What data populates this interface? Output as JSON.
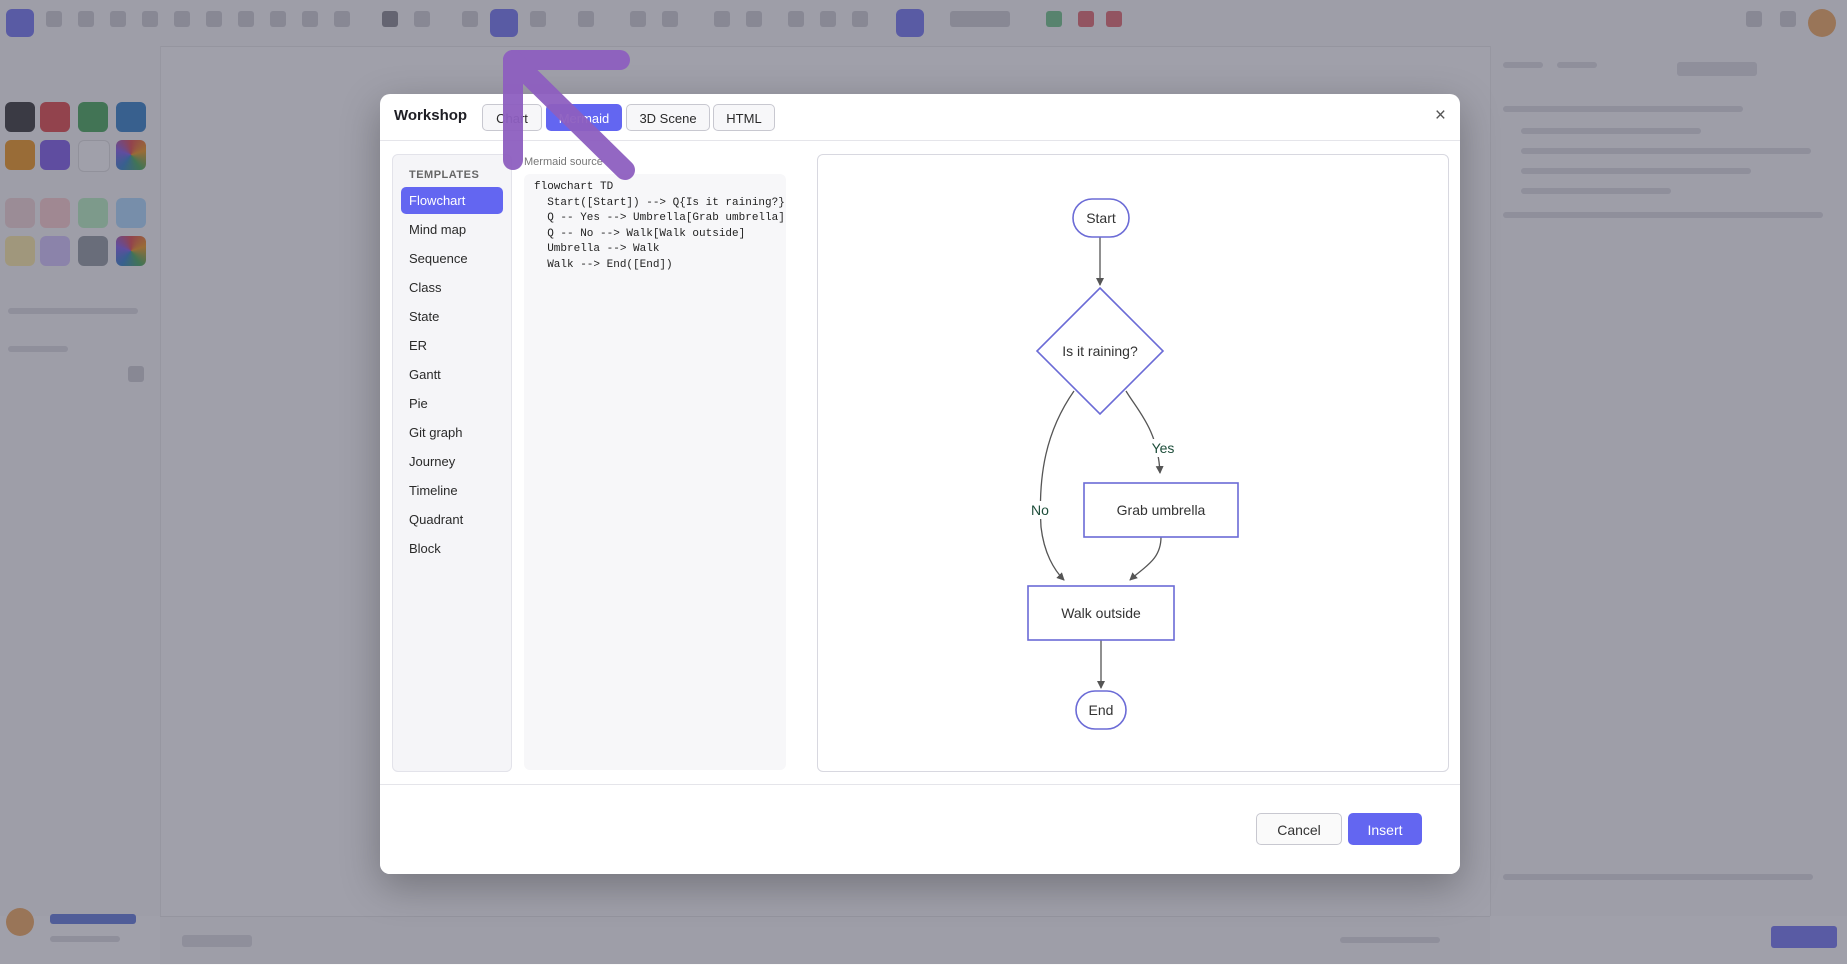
{
  "dialog": {
    "title": "Workshop",
    "close_glyph": "×",
    "tabs": [
      {
        "label": "Chart",
        "active": false
      },
      {
        "label": "Mermaid",
        "active": true
      },
      {
        "label": "3D Scene",
        "active": false
      },
      {
        "label": "HTML",
        "active": false
      }
    ],
    "templates_heading": "TEMPLATES",
    "templates": [
      "Flowchart",
      "Mind map",
      "Sequence",
      "Class",
      "State",
      "ER",
      "Gantt",
      "Pie",
      "Git graph",
      "Journey",
      "Timeline",
      "Quadrant",
      "Block"
    ],
    "active_template": "Flowchart",
    "source_label": "Mermaid source",
    "source_code": "flowchart TD\n  Start([Start]) --> Q{Is it raining?}\n  Q -- Yes --> Umbrella[Grab umbrella]\n  Q -- No --> Walk[Walk outside]\n  Umbrella --> Walk\n  Walk --> End([End])",
    "cancel_label": "Cancel",
    "insert_label": "Insert"
  },
  "diagram": {
    "nodes": {
      "start": "Start",
      "question": "Is it raining?",
      "umbrella": "Grab umbrella",
      "walk": "Walk outside",
      "end": "End"
    },
    "edge_labels": {
      "yes": "Yes",
      "no": "No"
    },
    "colors": {
      "node_stroke": "#6b6bd6",
      "edge": "#555555",
      "edge_label": "#1d4d3a"
    }
  },
  "colors": {
    "accent": "#6366f1",
    "annotation_arrow": "#8e5fc0"
  }
}
